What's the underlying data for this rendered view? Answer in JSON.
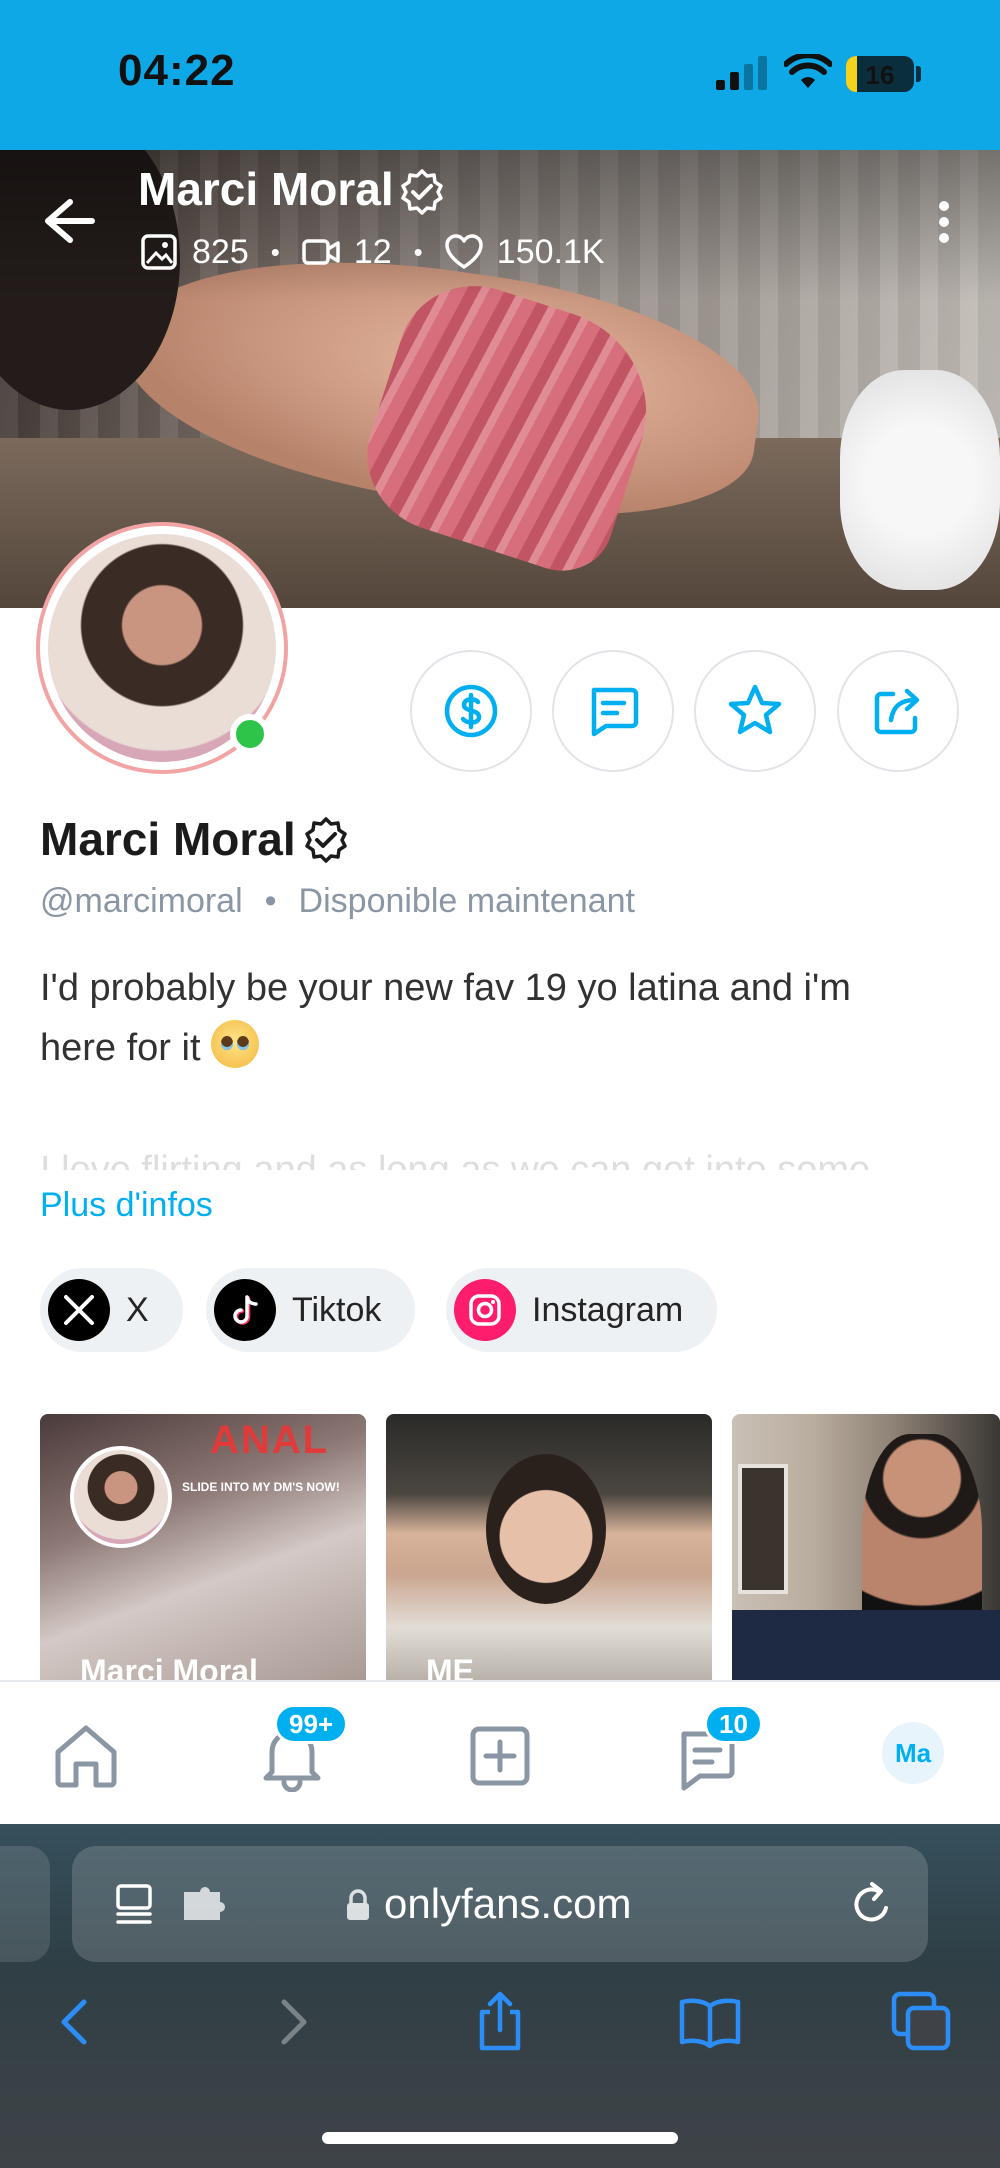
{
  "status_bar": {
    "time": "04:22",
    "battery": "16",
    "battery_level": 0.16
  },
  "header": {
    "name": "Marci Moral",
    "photos": "825",
    "videos": "12",
    "likes": "150.1K"
  },
  "profile": {
    "name": "Marci Moral",
    "handle": "@marcimoral",
    "availability": "Disponible maintenant",
    "bio_line1": "I'd probably be your new fav 19 yo latina and i'm",
    "bio_line2": "here for it",
    "bio_faded": "I love flirting and as long as we can get into some",
    "more_info": "Plus d'infos"
  },
  "socials": [
    {
      "label": "X",
      "icon": "x-logo-icon"
    },
    {
      "label": "Tiktok",
      "icon": "tiktok-icon"
    },
    {
      "label": "Instagram",
      "icon": "instagram-icon"
    }
  ],
  "stories": [
    {
      "label": "Marci Moral",
      "overlay_title": "ANAL",
      "overlay_sub": "SLIDE INTO MY DM'S NOW!"
    },
    {
      "label": "ME"
    },
    {
      "label": ""
    }
  ],
  "bottom_nav": {
    "notifications_badge": "99+",
    "messages_badge": "10",
    "avatar_initials": "Ma"
  },
  "browser": {
    "url": "onlyfans.com"
  },
  "colors": {
    "accent": "#00aff0",
    "status_bar": "#0fa8e6",
    "online": "#2ec44a"
  }
}
